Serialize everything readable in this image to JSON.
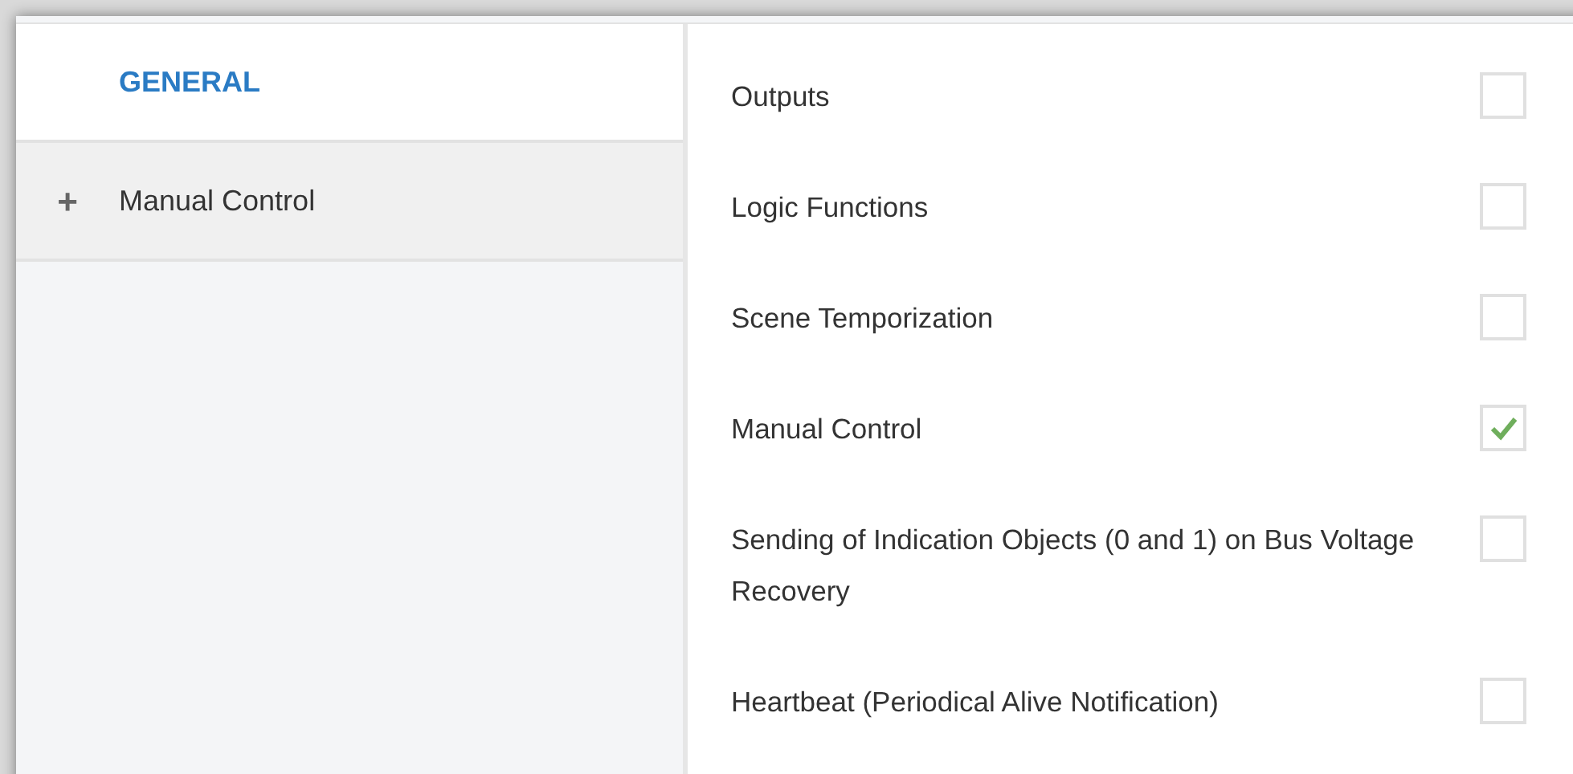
{
  "sidebar": {
    "items": [
      {
        "label": "GENERAL",
        "selected": true
      },
      {
        "label": "Manual Control",
        "selected": false,
        "expander": "+"
      }
    ]
  },
  "options": [
    {
      "label": "Outputs",
      "checked": false
    },
    {
      "label": "Logic Functions",
      "checked": false
    },
    {
      "label": "Scene Temporization",
      "checked": false
    },
    {
      "label": "Manual Control",
      "checked": true
    },
    {
      "label": "Sending of Indication Objects (0 and 1) on Bus Voltage Recovery",
      "checked": false
    },
    {
      "label": "Heartbeat (Periodical Alive Notification)",
      "checked": false
    }
  ]
}
